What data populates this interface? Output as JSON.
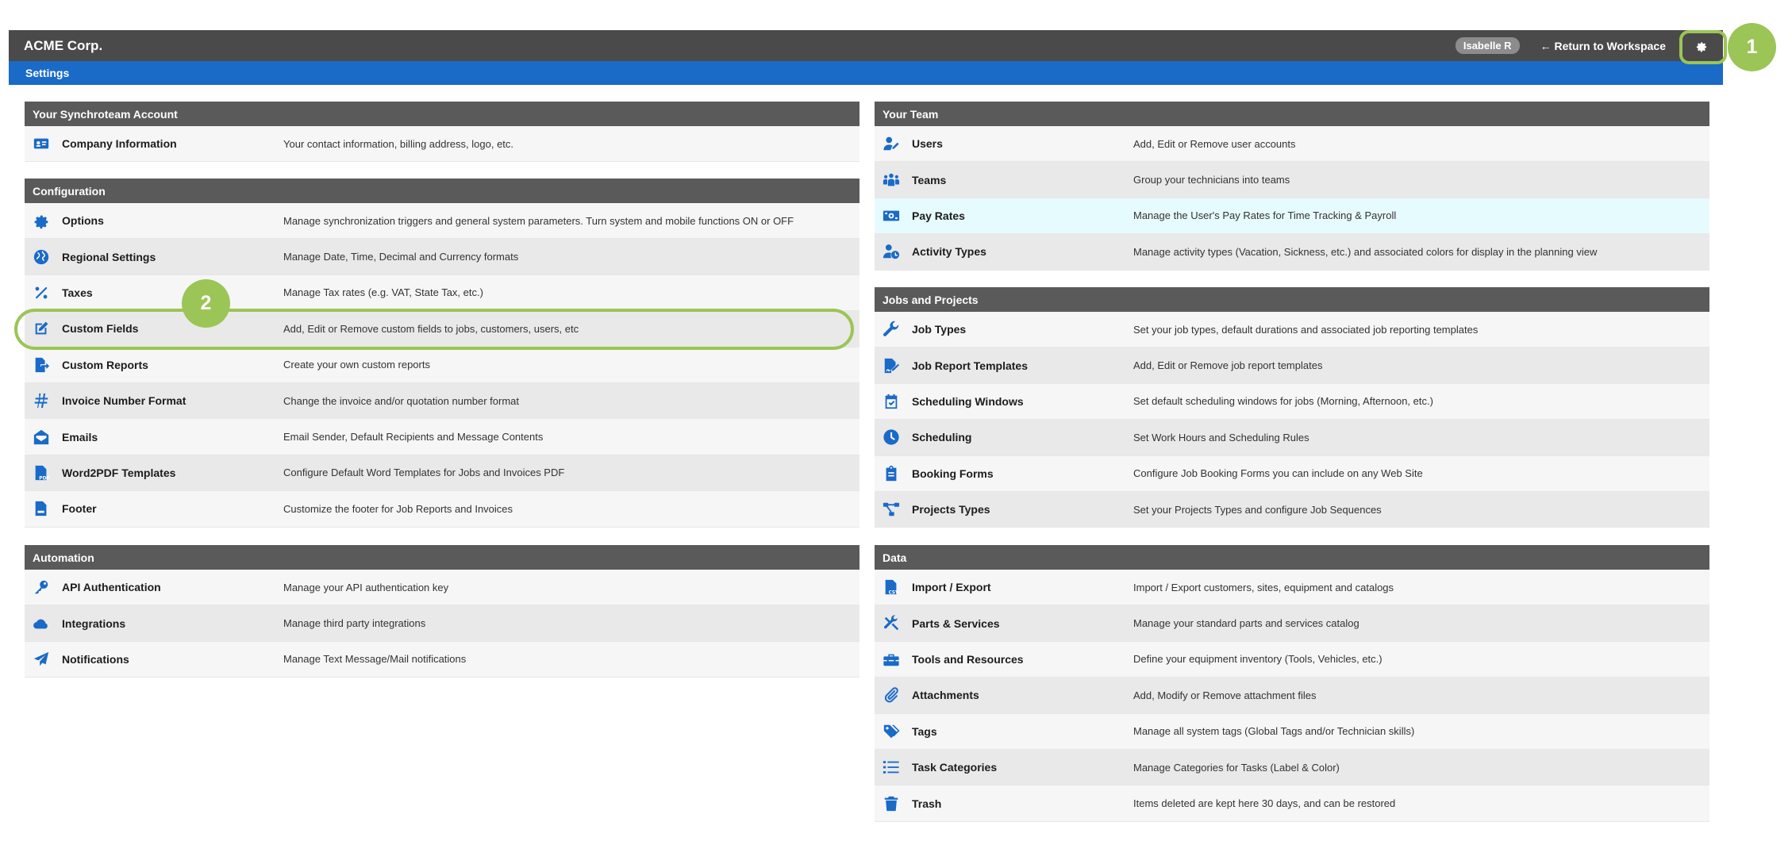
{
  "header": {
    "brand": "ACME Corp.",
    "user": "Isabelle R",
    "return_link": "← Return to Workspace",
    "settings_icon": "gear-icon"
  },
  "subnav": {
    "label": "Settings"
  },
  "callouts": {
    "first": "1",
    "second": "2"
  },
  "sections": {
    "account": {
      "title": "Your Synchroteam Account",
      "items": [
        {
          "icon": "id-card-icon",
          "name": "Company Information",
          "desc": "Your contact information, billing address, logo, etc."
        }
      ]
    },
    "configuration": {
      "title": "Configuration",
      "items": [
        {
          "icon": "gear-icon",
          "name": "Options",
          "desc": "Manage synchronization triggers and general system parameters. Turn system and mobile functions ON or OFF"
        },
        {
          "icon": "globe-icon",
          "name": "Regional Settings",
          "desc": "Manage Date, Time, Decimal and Currency formats"
        },
        {
          "icon": "percent-icon",
          "name": "Taxes",
          "desc": "Manage Tax rates (e.g. VAT, State Tax, etc.)"
        },
        {
          "icon": "edit-icon",
          "name": "Custom Fields",
          "desc": "Add, Edit or Remove custom fields to jobs, customers, users, etc"
        },
        {
          "icon": "file-export-icon",
          "name": "Custom Reports",
          "desc": "Create your own custom reports"
        },
        {
          "icon": "hashtag-icon",
          "name": "Invoice Number Format",
          "desc": "Change the invoice and/or quotation number format"
        },
        {
          "icon": "envelope-open-icon",
          "name": "Emails",
          "desc": "Email Sender, Default Recipients and Message Contents"
        },
        {
          "icon": "file-pdf-icon",
          "name": "Word2PDF Templates",
          "desc": "Configure Default Word Templates for Jobs and Invoices PDF"
        },
        {
          "icon": "file-footer-icon",
          "name": "Footer",
          "desc": "Customize the footer for Job Reports and Invoices"
        }
      ]
    },
    "automation": {
      "title": "Automation",
      "items": [
        {
          "icon": "key-icon",
          "name": "API Authentication",
          "desc": "Manage your API authentication key"
        },
        {
          "icon": "cloud-icon",
          "name": "Integrations",
          "desc": "Manage third party integrations"
        },
        {
          "icon": "paper-plane-icon",
          "name": "Notifications",
          "desc": "Manage Text Message/Mail notifications"
        }
      ]
    },
    "team": {
      "title": "Your Team",
      "items": [
        {
          "icon": "user-edit-icon",
          "name": "Users",
          "desc": "Add, Edit or Remove user accounts"
        },
        {
          "icon": "users-icon",
          "name": "Teams",
          "desc": "Group your technicians into teams"
        },
        {
          "icon": "money-bill-icon",
          "name": "Pay Rates",
          "desc": "Manage the User's Pay Rates for Time Tracking & Payroll"
        },
        {
          "icon": "user-clock-icon",
          "name": "Activity Types",
          "desc": "Manage activity types (Vacation, Sickness, etc.) and associated colors for display in the planning view"
        }
      ]
    },
    "jobs": {
      "title": "Jobs and Projects",
      "items": [
        {
          "icon": "wrench-icon",
          "name": "Job Types",
          "desc": "Set your job types, default durations and associated job reporting templates"
        },
        {
          "icon": "file-signature-icon",
          "name": "Job Report Templates",
          "desc": "Add, Edit or Remove job report templates"
        },
        {
          "icon": "calendar-check-icon",
          "name": "Scheduling Windows",
          "desc": "Set default scheduling windows for jobs (Morning, Afternoon, etc.)"
        },
        {
          "icon": "clock-icon",
          "name": "Scheduling",
          "desc": "Set Work Hours and Scheduling Rules"
        },
        {
          "icon": "clipboard-icon",
          "name": "Booking Forms",
          "desc": "Configure Job Booking Forms you can include on any Web Site"
        },
        {
          "icon": "project-diagram-icon",
          "name": "Projects Types",
          "desc": "Set your Projects Types and configure Job Sequences"
        }
      ]
    },
    "data": {
      "title": "Data",
      "items": [
        {
          "icon": "file-csv-icon",
          "name": "Import / Export",
          "desc": "Import / Export customers, sites, equipment and catalogs"
        },
        {
          "icon": "tools-icon",
          "name": "Parts & Services",
          "desc": "Manage your standard parts and services catalog"
        },
        {
          "icon": "toolbox-icon",
          "name": "Tools and Resources",
          "desc": "Define your equipment inventory (Tools, Vehicles, etc.)"
        },
        {
          "icon": "paperclip-icon",
          "name": "Attachments",
          "desc": "Add, Modify or Remove attachment files"
        },
        {
          "icon": "tags-icon",
          "name": "Tags",
          "desc": "Manage all system tags (Global Tags and/or Technician skills)"
        },
        {
          "icon": "list-icon",
          "name": "Task Categories",
          "desc": "Manage Categories for Tasks (Label & Color)"
        },
        {
          "icon": "trash-icon",
          "name": "Trash",
          "desc": "Items deleted are kept here 30 days, and can be restored"
        }
      ]
    }
  },
  "colors": {
    "topbar": "#4a4a4a",
    "subbar": "#1a6ac8",
    "panel_header": "#5a5a5a",
    "icon_blue": "#1a6ac8",
    "callout_green": "#9bc556",
    "highlight_row": "#e6fbfd"
  }
}
